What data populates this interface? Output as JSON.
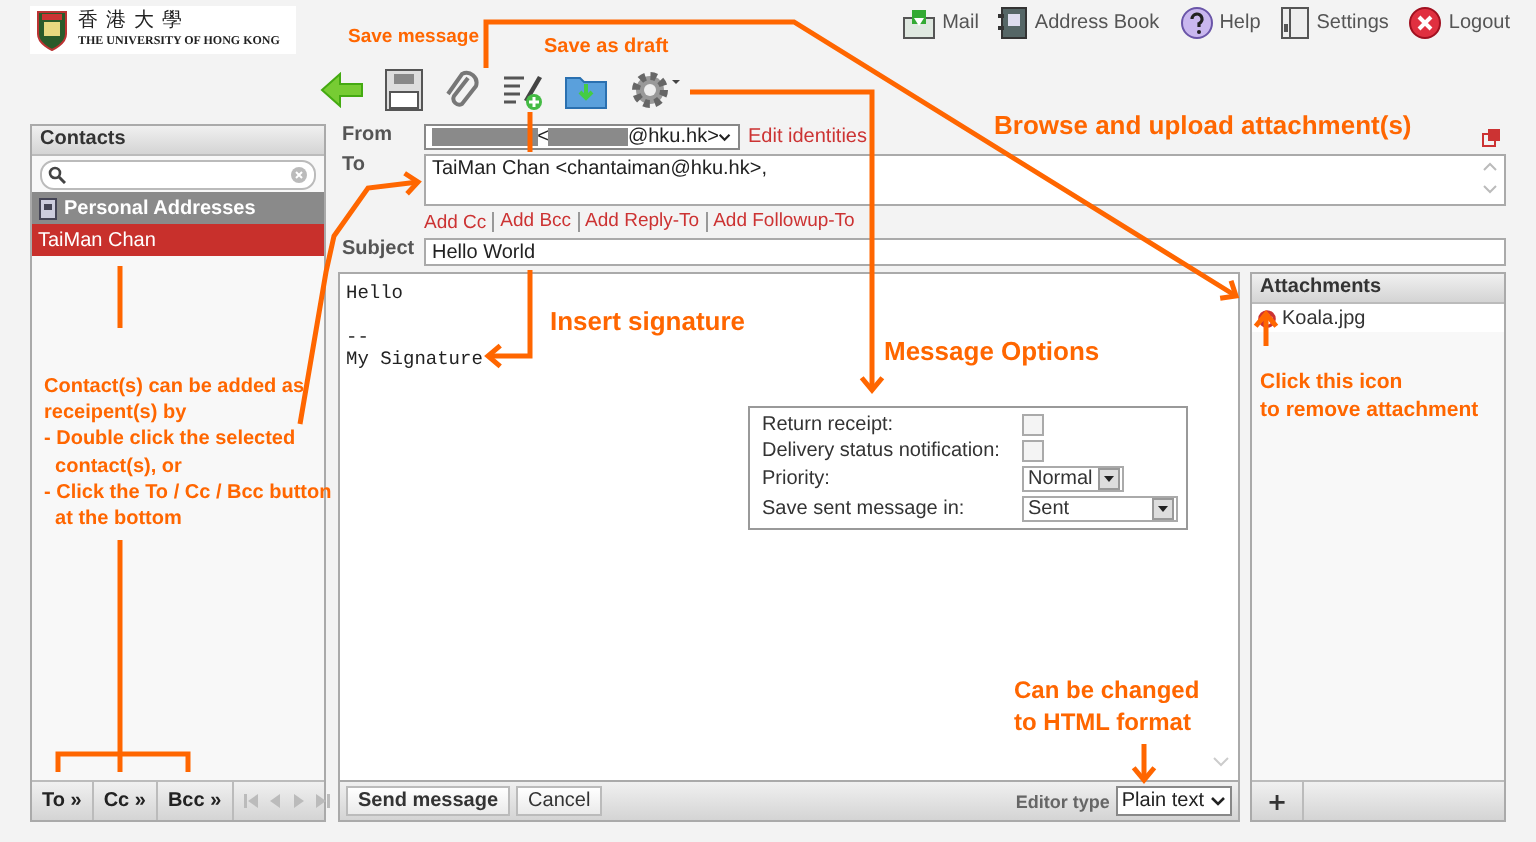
{
  "header": {
    "logo_lines": [
      "香港大學",
      "THE UNIVERSITY OF HONG KONG"
    ],
    "nav": [
      {
        "kind": "mail",
        "label": "Mail"
      },
      {
        "kind": "address-book",
        "label": "Address Book"
      },
      {
        "kind": "help",
        "label": "Help"
      },
      {
        "kind": "settings",
        "label": "Settings"
      },
      {
        "kind": "logout",
        "label": "Logout"
      }
    ]
  },
  "toolbar": [
    {
      "kind": "back"
    },
    {
      "kind": "save"
    },
    {
      "kind": "attach"
    },
    {
      "kind": "signature"
    },
    {
      "kind": "draft"
    },
    {
      "kind": "options"
    }
  ],
  "contacts": {
    "title": "Contacts",
    "groups": [
      {
        "label": "Personal Addresses"
      }
    ],
    "items": [
      {
        "label": "TaiMan Chan",
        "selected": true
      }
    ],
    "buttons": [
      "To »",
      "Cc »",
      "Bcc »"
    ]
  },
  "compose": {
    "from": {
      "label": "From",
      "segments": [
        "<",
        "@hku.hk>"
      ],
      "link": "Edit identities"
    },
    "to": {
      "label": "To",
      "value": "TaiMan Chan <chantaiman@hku.hk>,"
    },
    "links": [
      "Add Cc",
      "Add Bcc",
      "Add Reply-To",
      "Add Followup-To"
    ],
    "subject": {
      "label": "Subject",
      "value": "Hello World"
    },
    "body": "Hello\n\n--\nMy Signature",
    "options": [
      {
        "kind": "checkbox",
        "label": "Return receipt:",
        "checked": false
      },
      {
        "kind": "checkbox",
        "label": "Delivery status notification:",
        "checked": false
      },
      {
        "kind": "select",
        "label": "Priority:",
        "value": "Normal"
      },
      {
        "kind": "select",
        "label": "Save sent message in:",
        "value": "Sent"
      }
    ],
    "footer": {
      "send": "Send message",
      "cancel": "Cancel",
      "editor_label": "Editor type",
      "editor_value": "Plain text"
    }
  },
  "attachments": {
    "title": "Attachments",
    "items": [
      {
        "name": "Koala.jpg"
      }
    ],
    "add_button": "+"
  },
  "annotations": [
    {
      "text": "Save message"
    },
    {
      "text": "Save as draft"
    },
    {
      "text": "Browse and upload attachment(s)"
    },
    {
      "text": "Insert signature"
    },
    {
      "text": "Message Options"
    },
    {
      "text": "Contact(s) can be added as\nreceipent(s) by\n- Double click the selected\n  contact(s), or\n- Click the To / Cc / Bcc button\n  at the bottom"
    },
    {
      "text": "Click this icon\nto remove attachment"
    },
    {
      "text": "Can be changed\nto HTML format"
    }
  ]
}
